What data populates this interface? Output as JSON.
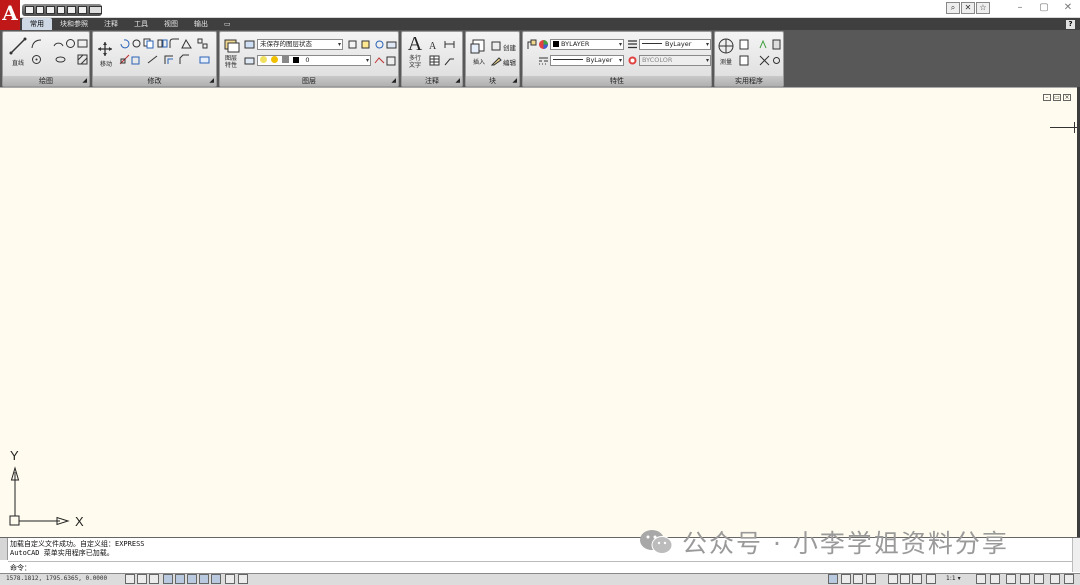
{
  "app": {
    "logo_letter": "A"
  },
  "ribbon": {
    "tabs": [
      "常用",
      "块和参照",
      "注释",
      "工具",
      "视图",
      "输出",
      "▭"
    ],
    "active_tab": 0,
    "help_label": "?",
    "panels": {
      "draw": {
        "title": "绘图",
        "line_label": "直线"
      },
      "modify": {
        "title": "修改",
        "move_label": "移动"
      },
      "layers": {
        "title": "图层",
        "layer_props_label": "图层\n特性",
        "layer_state_combo": "未保存的图层状态",
        "layer_combo": "0"
      },
      "annotation": {
        "title": "注释",
        "mtext_letter": "A",
        "mtext_label": "多行\n文字"
      },
      "block": {
        "title": "块",
        "insert_label": "插入",
        "create_label": "创建",
        "edit_label": "编辑"
      },
      "properties": {
        "title": "特性",
        "color_combo": "BYLAYER",
        "linetype_combo": "ByLayer",
        "lineweight_combo": "ByLayer",
        "plotstyle_combo": "BYCOLOR"
      },
      "utilities": {
        "title": "实用程序",
        "measure_label": "测量"
      }
    }
  },
  "drawing": {
    "ucs_y": "Y",
    "ucs_x": "X",
    "background": "#fffbee"
  },
  "command": {
    "history": [
      "加载自定义文件成功。自定义组：EXPRESS",
      "AutoCAD 菜单实用程序已加载。"
    ],
    "prompt": "命令："
  },
  "status": {
    "coords": "1578.1812, 1795.6365, 0.0000",
    "annotation_scale": "1:1"
  },
  "watermark": {
    "text": "公众号 · 小李学姐资料分享"
  }
}
